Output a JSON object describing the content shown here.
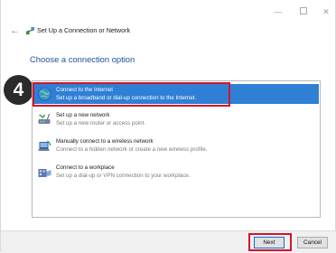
{
  "window": {
    "title": "Set Up a Connection or Network",
    "controls": {
      "minimize": "—",
      "close": "✕"
    }
  },
  "main": {
    "heading": "Choose a connection option",
    "step_number": "4",
    "options": [
      {
        "title": "Connect to the Internet",
        "desc": "Set up a broadband or dial-up connection to the Internet.",
        "icon": "globe-icon",
        "selected": true
      },
      {
        "title": "Set up a new network",
        "desc": "Set up a new router or access point.",
        "icon": "router-icon",
        "selected": false
      },
      {
        "title": "Manually connect to a wireless network",
        "desc": "Connect to a hidden network or create a new wireless profile.",
        "icon": "wireless-icon",
        "selected": false
      },
      {
        "title": "Connect to a workplace",
        "desc": "Set up a dial-up or VPN connection to your workplace.",
        "icon": "workplace-icon",
        "selected": false
      }
    ]
  },
  "footer": {
    "next_label": "Next",
    "cancel_label": "Cancel"
  },
  "colors": {
    "selection": "#2f7fd5",
    "heading": "#1c4e9c",
    "annotation": "#d3142a",
    "badge": "#2b2b2b"
  }
}
